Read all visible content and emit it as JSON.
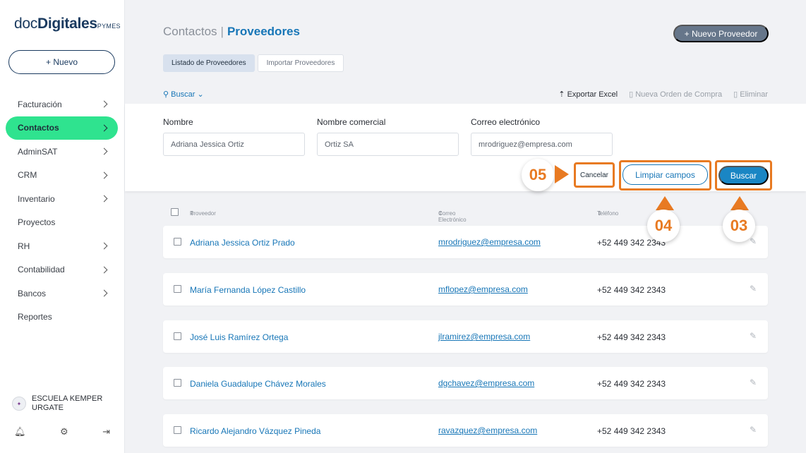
{
  "brand": {
    "part1": "doc",
    "part2": "Digitales",
    "part3": "PYMES"
  },
  "sidebar": {
    "new_button": "+ Nuevo",
    "items": [
      {
        "label": "Facturación",
        "chevron": true,
        "active": false
      },
      {
        "label": "Contactos",
        "chevron": true,
        "active": true
      },
      {
        "label": "AdminSAT",
        "chevron": true,
        "active": false
      },
      {
        "label": "CRM",
        "chevron": true,
        "active": false
      },
      {
        "label": "Inventario",
        "chevron": true,
        "active": false
      },
      {
        "label": "Proyectos",
        "chevron": false,
        "active": false
      },
      {
        "label": "RH",
        "chevron": true,
        "active": false
      },
      {
        "label": "Contabilidad",
        "chevron": true,
        "active": false
      },
      {
        "label": "Bancos",
        "chevron": true,
        "active": false
      },
      {
        "label": "Reportes",
        "chevron": false,
        "active": false
      }
    ],
    "org_name": "ESCUELA KEMPER URGATE",
    "footer_icons": [
      "bell-icon",
      "gear-icon",
      "logout-icon"
    ]
  },
  "header": {
    "breadcrumb_parent": "Contactos",
    "breadcrumb_separator": "|",
    "breadcrumb_current": "Proveedores",
    "new_button": "+ Nuevo Proveedor"
  },
  "tabs": [
    {
      "label": "Listado de Proveedores",
      "active": true
    },
    {
      "label": "Importar Proveedores",
      "active": false
    }
  ],
  "toolbar": {
    "search_toggle": "Buscar",
    "export": "Exportar Excel",
    "new_order": "Nueva Orden de Compra",
    "delete": "Eliminar"
  },
  "search": {
    "nombre_label": "Nombre",
    "nombre_value": "Adriana Jessica Ortiz",
    "comercial_label": "Nombre comercial",
    "comercial_value": "Ortiz SA",
    "email_label": "Correo electrónico",
    "email_value": "mrodriguez@empresa.com",
    "cancel": "Cancelar",
    "clear": "Limpiar campos",
    "search": "Buscar"
  },
  "callouts": {
    "c05": "05",
    "c04": "04",
    "c03": "03"
  },
  "table": {
    "headers": {
      "proveedor": "Proveedor",
      "email": "Correo Electrónico",
      "phone": "Teléfono"
    },
    "rows": [
      {
        "name": "Adriana Jessica Ortiz Prado",
        "email": "mrodriguez@empresa.com",
        "phone": "+52 449 342 2343"
      },
      {
        "name": "María Fernanda López Castillo",
        "email": "mflopez@empresa.com",
        "phone": "+52 449 342 2343"
      },
      {
        "name": "José Luis Ramírez Ortega",
        "email": "jlramirez@empresa.com",
        "phone": "+52 449 342 2343"
      },
      {
        "name": "Daniela Guadalupe Chávez Morales",
        "email": "dgchavez@empresa.com",
        "phone": "+52 449 342 2343"
      },
      {
        "name": "Ricardo Alejandro Vázquez Pineda",
        "email": "ravazquez@empresa.com",
        "phone": "+52 449 342 2343"
      }
    ]
  },
  "colors": {
    "accent": "#1776b7",
    "active_nav": "#2fe38f",
    "callout": "#e87a22",
    "primary_button": "#1a86c4"
  }
}
